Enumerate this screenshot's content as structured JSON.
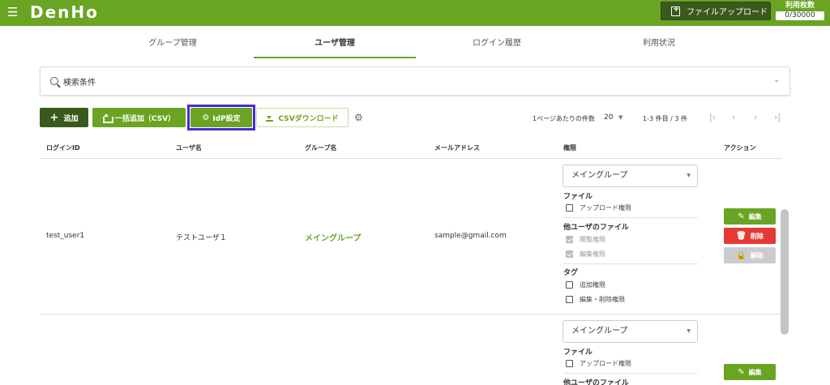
{
  "header": {
    "menu_icon": "hamburger-icon",
    "logo": "DenHo",
    "upload_label": "ファイルアップロード",
    "count_label": "利用枚数",
    "count_value": "0/30000",
    "bar_color": "#6aa423"
  },
  "tabs": [
    {
      "label": "グループ管理",
      "active": false
    },
    {
      "label": "ユーザ管理",
      "active": true
    },
    {
      "label": "ログイン履歴",
      "active": false
    },
    {
      "label": "利用状況",
      "active": false
    }
  ],
  "search": {
    "label": "検索条件"
  },
  "toolbar": {
    "add_label": "追加",
    "bulk_label": "一括追加（CSV）",
    "idp_label": "IdP設定",
    "csv_label": "CSVダウンロード",
    "per_page_label": "1ページあたりの件数",
    "per_page_value": "20",
    "range_label": "1-3 件目 / 3 件"
  },
  "table": {
    "columns": [
      "ログインID",
      "ユーザ名",
      "グループ名",
      "メールアドレス",
      "権限",
      "アクション"
    ],
    "rows": [
      {
        "login_id": "test_user1",
        "user_name": "テストユーザ１",
        "group": "メイングループ",
        "email": "sample@gmail.com",
        "select": "メイングループ",
        "perm_file": "ファイル",
        "perm_upload": "アップロード権限",
        "perm_other": "他ユーザのファイル",
        "perm_view": "閲覧権限",
        "perm_edit": "編集権限",
        "perm_tag": "タグ",
        "perm_tag_add": "追加権限",
        "perm_tag_edit": "編集・削除権限",
        "act_edit": "編集",
        "act_delete": "削除",
        "act_unlock": "解除"
      },
      {
        "select": "メイングループ",
        "perm_file": "ファイル",
        "perm_upload": "アップロード権限",
        "perm_other": "他ユーザのファイル",
        "act_edit": "編集"
      }
    ]
  }
}
